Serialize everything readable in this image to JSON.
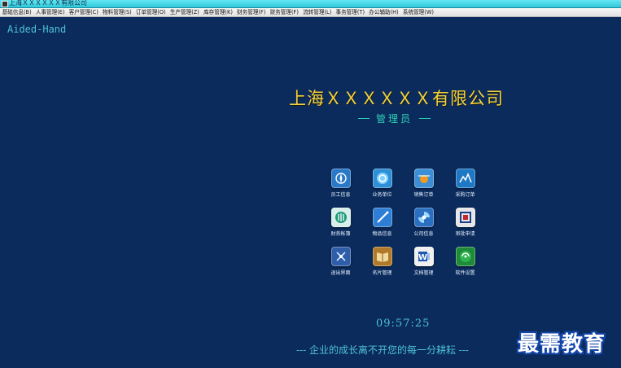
{
  "window": {
    "title": "上海ＸＸＸＸＸＸ有限公司"
  },
  "menubar": {
    "items": [
      "基础信息(B)",
      "人事管理(E)",
      "客户管理(C)",
      "物料管理(S)",
      "订单管理(O)",
      "生产管理(Z)",
      "库存管理(K)",
      "财务管理(F)",
      "财务管理(F)",
      "流转管理(L)",
      "事务管理(T)",
      "办公辅助(H)",
      "系统管理(W)"
    ]
  },
  "header": {
    "brand": "Aided-Hand",
    "company": "上海ＸＸＸＸＸＸ有限公司",
    "role": "管理员"
  },
  "tiles": [
    {
      "label": "员工信息",
      "icon": "compass-icon",
      "color": "#2a78c8"
    },
    {
      "label": "业务单位",
      "icon": "orb-icon",
      "color": "#2d8fd6"
    },
    {
      "label": "销售订单",
      "icon": "sun-icon",
      "color": "#e68a1f"
    },
    {
      "label": "采购订单",
      "icon": "chart-icon",
      "color": "#1f78c4"
    },
    {
      "label": "财务帐簿",
      "icon": "shield-icon",
      "color": "#1f9a7c"
    },
    {
      "label": "物品信息",
      "icon": "pen-icon",
      "color": "#2d7ed4"
    },
    {
      "label": "公司信息",
      "icon": "swirl-icon",
      "color": "#2a6fc0"
    },
    {
      "label": "审批申请",
      "icon": "loop-icon",
      "color": "#dcdcdc"
    },
    {
      "label": "退出界面",
      "icon": "ruler-icon",
      "color": "#2f5da8"
    },
    {
      "label": "名片管理",
      "icon": "book-icon",
      "color": "#b07a2a"
    },
    {
      "label": "文档管理",
      "icon": "word-icon",
      "color": "#f0f0f0"
    },
    {
      "label": "软件设置",
      "icon": "globe-icon",
      "color": "#1f8a3a"
    }
  ],
  "status": {
    "clock": "09:57:25",
    "motto": "---  企业的成长离不开您的每一分耕耘  ---"
  },
  "watermark": "最需教育"
}
